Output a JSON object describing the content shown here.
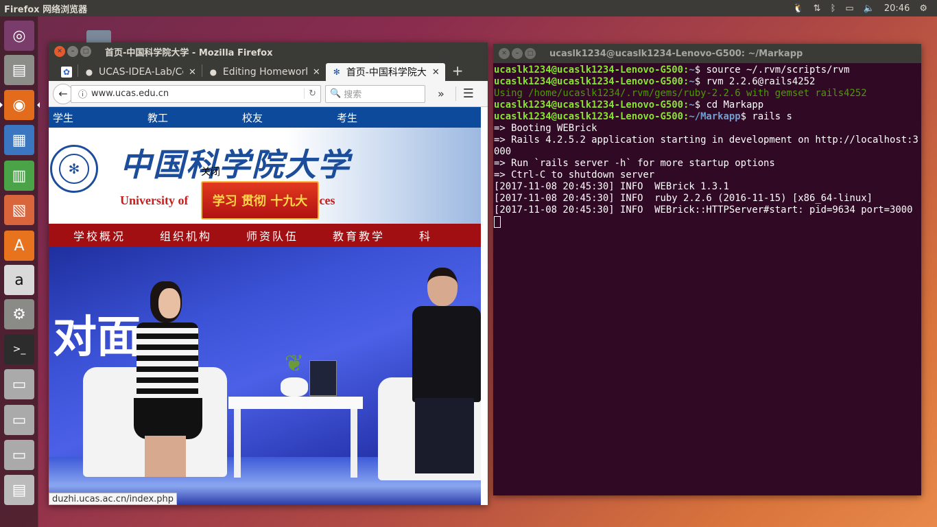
{
  "top_panel": {
    "app_title": "Firefox 网络浏览器",
    "clock": "20:46",
    "indicators": [
      "tux-icon",
      "network-icon",
      "bluetooth-icon",
      "battery-icon",
      "volume-icon",
      "settings-icon"
    ]
  },
  "launcher": {
    "items": [
      {
        "name": "dash",
        "glyph": "◎"
      },
      {
        "name": "files",
        "glyph": "▤"
      },
      {
        "name": "firefox",
        "glyph": "◉"
      },
      {
        "name": "writer",
        "glyph": "▦"
      },
      {
        "name": "calc",
        "glyph": "▥"
      },
      {
        "name": "impress",
        "glyph": "▧"
      },
      {
        "name": "software-center",
        "glyph": "A"
      },
      {
        "name": "amazon",
        "glyph": "a"
      },
      {
        "name": "system-settings",
        "glyph": "⚙"
      },
      {
        "name": "terminal",
        "glyph": ">_"
      },
      {
        "name": "drive-1",
        "glyph": "▭"
      },
      {
        "name": "drive-2",
        "glyph": "▭"
      },
      {
        "name": "drive-3",
        "glyph": "▭"
      },
      {
        "name": "trash",
        "glyph": "▤"
      }
    ]
  },
  "firefox": {
    "window_title": "首页-中国科学院大学 - Mozilla Firefox",
    "tabs": [
      {
        "title": "",
        "icon": "paw-icon"
      },
      {
        "title": "UCAS-IDEA-Lab/Co",
        "icon": "github-icon"
      },
      {
        "title": "Editing Homework",
        "icon": "github-icon"
      },
      {
        "title": "首页-中国科学院大",
        "icon": "ucas-icon"
      }
    ],
    "url": "www.ucas.edu.cn",
    "search_placeholder": "搜索",
    "status_url": "duzhi.ucas.ac.cn/index.php",
    "page": {
      "top_nav": [
        "学生",
        "教工",
        "校友",
        "考生"
      ],
      "cn_name": "中国科学院大学",
      "en_name_left": "University of",
      "en_name_right": "Sciences",
      "close_text": "关闭",
      "promo_text": "学习 贯彻 十九大",
      "main_nav": [
        "学校概况",
        "组织机构",
        "师资队伍",
        "教育教学",
        "科"
      ],
      "hero_text": "对面"
    }
  },
  "terminal": {
    "window_title": "ucaslk1234@ucaslk1234-Lenovo-G500: ~/Markapp",
    "lines": [
      {
        "user": "ucaslk1234@ucaslk1234-Lenovo-G500",
        "path": "~",
        "cmd": "$ source ~/.rvm/scripts/rvm"
      },
      {
        "user": "ucaslk1234@ucaslk1234-Lenovo-G500",
        "path": "~",
        "cmd": "$ rvm 2.2.6@rails4252"
      },
      {
        "green": "Using /home/ucaslk1234/.rvm/gems/ruby-2.2.6 with gemset rails4252"
      },
      {
        "user": "ucaslk1234@ucaslk1234-Lenovo-G500",
        "path": "~",
        "cmd": "$ cd Markapp"
      },
      {
        "user": "ucaslk1234@ucaslk1234-Lenovo-G500",
        "path": "~/Markapp",
        "cmd": "$ rails s"
      },
      {
        "text": "=> Booting WEBrick"
      },
      {
        "text": "=> Rails 4.2.5.2 application starting in development on http://localhost:3000"
      },
      {
        "text": "=> Run `rails server -h` for more startup options"
      },
      {
        "text": "=> Ctrl-C to shutdown server"
      },
      {
        "text": "[2017-11-08 20:45:30] INFO  WEBrick 1.3.1"
      },
      {
        "text": "[2017-11-08 20:45:30] INFO  ruby 2.2.6 (2016-11-15) [x86_64-linux]"
      },
      {
        "text": "[2017-11-08 20:45:30] INFO  WEBrick::HTTPServer#start: pid=9634 port=3000"
      }
    ]
  }
}
